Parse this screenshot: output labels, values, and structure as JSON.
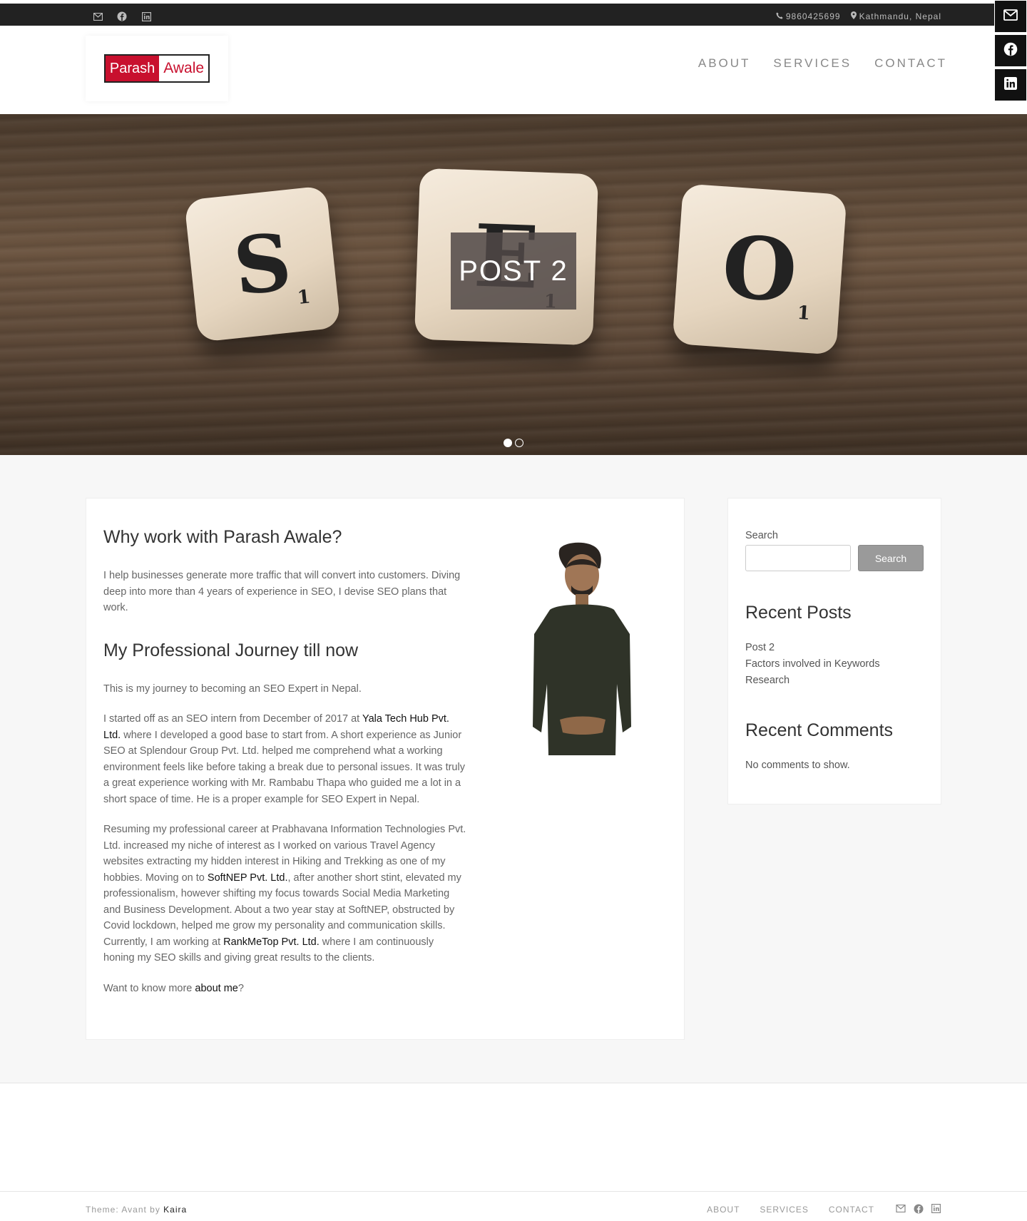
{
  "topbar": {
    "social_icons": [
      "envelope-icon",
      "facebook-icon",
      "linkedin-icon"
    ],
    "phone": "9860425699",
    "location": "Kathmandu, Nepal"
  },
  "side_social": [
    "envelope-icon",
    "facebook-icon",
    "linkedin-icon"
  ],
  "header": {
    "logo_part1": "Parash",
    "logo_part2": "Awale",
    "nav": [
      "ABOUT",
      "SERVICES",
      "CONTACT"
    ]
  },
  "hero": {
    "title": "POST 2",
    "tiles": [
      "S",
      "E",
      "O"
    ],
    "tile_subscripts": [
      "1",
      "1",
      "1"
    ],
    "slides": 2,
    "active_slide": 1
  },
  "main": {
    "heading1": "Why work with Parash Awale?",
    "intro": "I help businesses generate more traffic that will convert into customers. Diving deep into more than 4 years of experience in SEO, I devise SEO plans that work.",
    "heading2": "My Professional Journey till now",
    "p1": "This is my journey to becoming an SEO Expert in Nepal.",
    "p2_a": "I started off as an SEO intern from December of 2017 at ",
    "p2_link": "Yala Tech Hub Pvt. Ltd.",
    "p2_b": " where I developed a good base to start from. A short experience as Junior SEO at Splendour Group Pvt. Ltd. helped me comprehend what a working environment feels like before taking a break due to personal issues. It was truly a great experience working with Mr. Rambabu Thapa who guided me a lot in a short space of time. He is a proper example for SEO Expert in Nepal.",
    "p3_a": "Resuming my professional career at Prabhavana Information Technologies Pvt. Ltd. increased my niche of interest as I worked on various Travel Agency websites extracting my hidden interest in Hiking and Trekking as one of my hobbies. Moving on to ",
    "p3_link1": "SoftNEP Pvt. Ltd.",
    "p3_b": ", after another short stint, elevated my professionalism, however shifting my focus towards Social Media Marketing and Business Development. About a two year stay at SoftNEP, obstructed by Covid lockdown, helped me grow my personality and communication skills. Currently, I am working at ",
    "p3_link2": "RankMeTop Pvt. Ltd.",
    "p3_c": " where I am continuously honing my SEO skills and giving great results to the clients.",
    "p4_a": "Want to know more ",
    "p4_link": "about me",
    "p4_b": "?"
  },
  "sidebar": {
    "search_label": "Search",
    "search_value": "",
    "search_button": "Search",
    "recent_posts_title": "Recent Posts",
    "recent_posts": [
      "Post 2",
      "Factors involved in Keywords Research"
    ],
    "recent_comments_title": "Recent Comments",
    "no_comments": "No comments to show."
  },
  "footer": {
    "credit_prefix": "Theme: Avant by ",
    "credit_link": "Kaira",
    "nav": [
      "ABOUT",
      "SERVICES",
      "CONTACT"
    ],
    "social_icons": [
      "envelope-icon",
      "facebook-icon",
      "linkedin-icon"
    ]
  },
  "colors": {
    "brand_red": "#c8102e",
    "topbar_bg": "#222222",
    "side_social_bg": "#111111",
    "page_bg": "#f7f7f7"
  }
}
